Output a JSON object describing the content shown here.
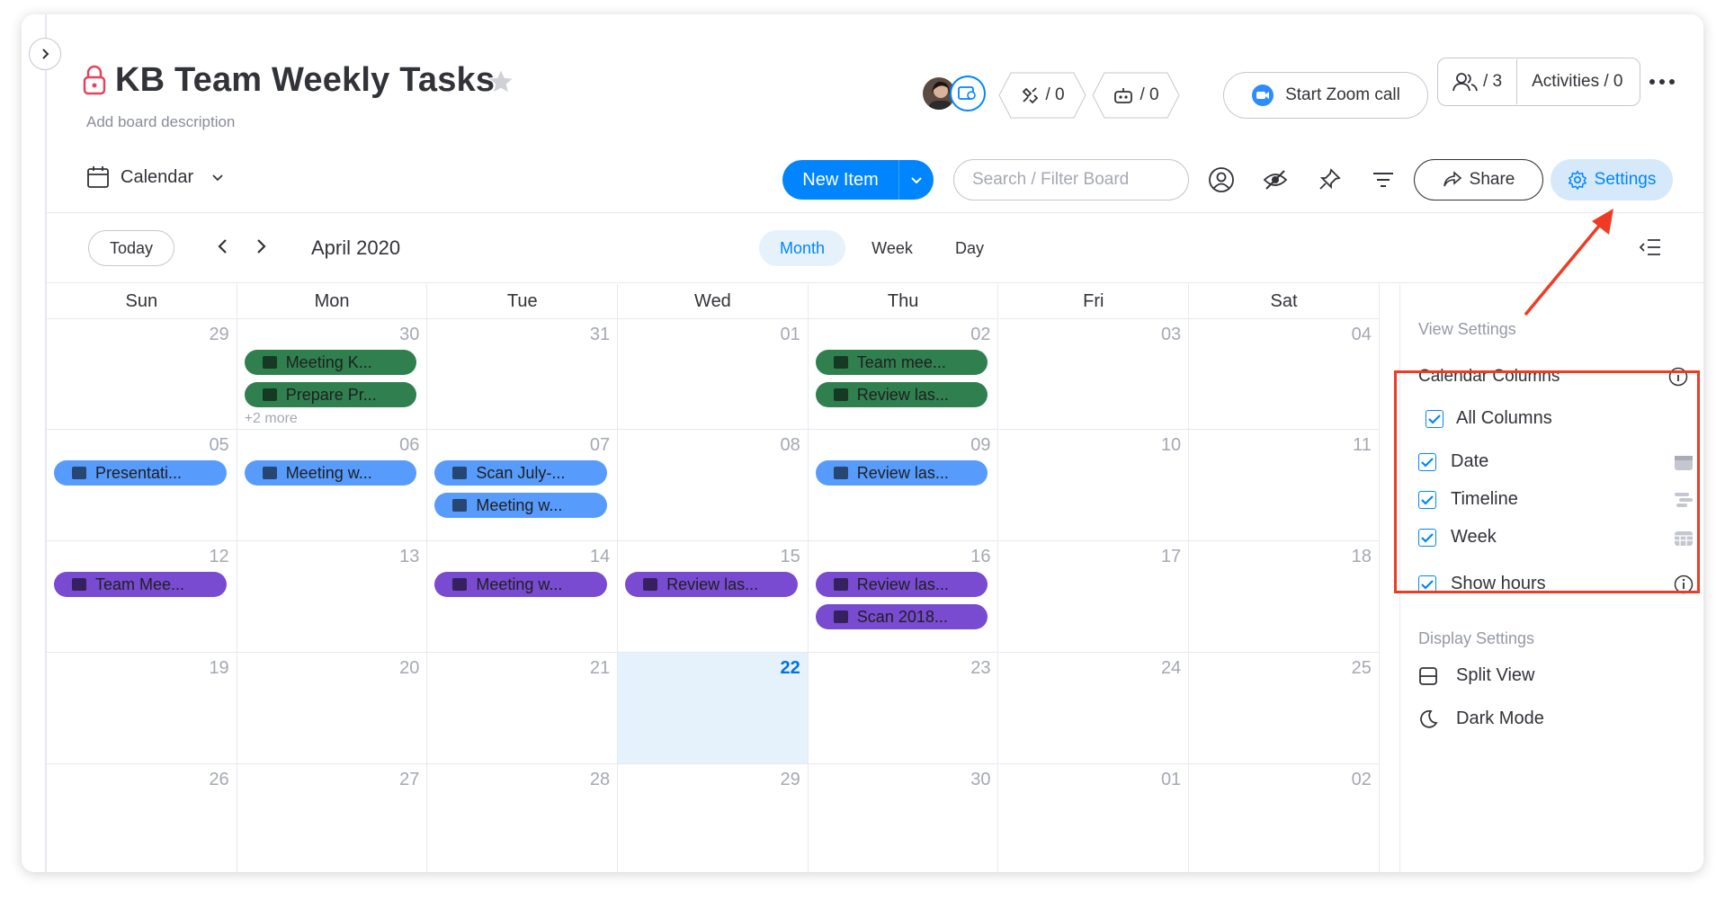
{
  "board": {
    "title": "KB Team Weekly Tasks",
    "description_placeholder": "Add board description"
  },
  "header": {
    "integrations_count": "/ 0",
    "automations_count": "/ 0",
    "zoom_label": "Start Zoom call",
    "members_count": "/ 3",
    "activities_label": "Activities / 0"
  },
  "toolbar": {
    "view_label": "Calendar",
    "new_item_label": "New Item",
    "search_placeholder": "Search / Filter Board",
    "share_label": "Share",
    "settings_label": "Settings"
  },
  "calendar": {
    "today_label": "Today",
    "month_label": "April 2020",
    "modes": [
      "Month",
      "Week",
      "Day"
    ],
    "active_mode": "Month",
    "weekdays": [
      "Sun",
      "Mon",
      "Tue",
      "Wed",
      "Thu",
      "Fri",
      "Sat"
    ],
    "weeks": [
      [
        {
          "day": "29",
          "events": []
        },
        {
          "day": "30",
          "events": [
            "Meeting K...",
            "Prepare Pr..."
          ],
          "more": "+2 more"
        },
        {
          "day": "31",
          "events": []
        },
        {
          "day": "01",
          "events": []
        },
        {
          "day": "02",
          "events": [
            "Team mee...",
            "Review las..."
          ]
        },
        {
          "day": "03",
          "events": []
        },
        {
          "day": "04",
          "events": []
        }
      ],
      [
        {
          "day": "05",
          "events": [
            "Presentati..."
          ]
        },
        {
          "day": "06",
          "events": [
            "Meeting w..."
          ]
        },
        {
          "day": "07",
          "events": [
            "Scan July-...",
            "Meeting w..."
          ]
        },
        {
          "day": "08",
          "events": []
        },
        {
          "day": "09",
          "events": [
            "Review las..."
          ]
        },
        {
          "day": "10",
          "events": []
        },
        {
          "day": "11",
          "events": []
        }
      ],
      [
        {
          "day": "12",
          "events": [
            "Team Mee..."
          ]
        },
        {
          "day": "13",
          "events": []
        },
        {
          "day": "14",
          "events": [
            "Meeting w..."
          ]
        },
        {
          "day": "15",
          "events": [
            "Review las..."
          ]
        },
        {
          "day": "16",
          "events": [
            "Review las...",
            "Scan 2018..."
          ]
        },
        {
          "day": "17",
          "events": []
        },
        {
          "day": "18",
          "events": []
        }
      ],
      [
        {
          "day": "19",
          "events": []
        },
        {
          "day": "20",
          "events": []
        },
        {
          "day": "21",
          "events": []
        },
        {
          "day": "22",
          "events": [],
          "today": true
        },
        {
          "day": "23",
          "events": []
        },
        {
          "day": "24",
          "events": []
        },
        {
          "day": "25",
          "events": []
        }
      ],
      [
        {
          "day": "26",
          "events": []
        },
        {
          "day": "27",
          "events": []
        },
        {
          "day": "28",
          "events": []
        },
        {
          "day": "29",
          "events": []
        },
        {
          "day": "30",
          "events": []
        },
        {
          "day": "01",
          "events": []
        },
        {
          "day": "02",
          "events": []
        }
      ]
    ],
    "week_colors": [
      "#2f7f4f",
      "#579bfc",
      "#784bd1",
      "#579bfc",
      "#579bfc"
    ],
    "today_color": "#0073ea",
    "today_bg": "#e5f1fb"
  },
  "settings_panel": {
    "view_settings_label": "View Settings",
    "calendar_columns_label": "Calendar Columns",
    "all_columns_label": "All Columns",
    "columns": [
      "Date",
      "Timeline",
      "Week"
    ],
    "show_hours_label": "Show hours",
    "display_settings_label": "Display Settings",
    "split_view_label": "Split View",
    "dark_mode_label": "Dark Mode"
  },
  "colors": {
    "primary": "#0085ff",
    "highlight_red": "#ef3b24"
  }
}
